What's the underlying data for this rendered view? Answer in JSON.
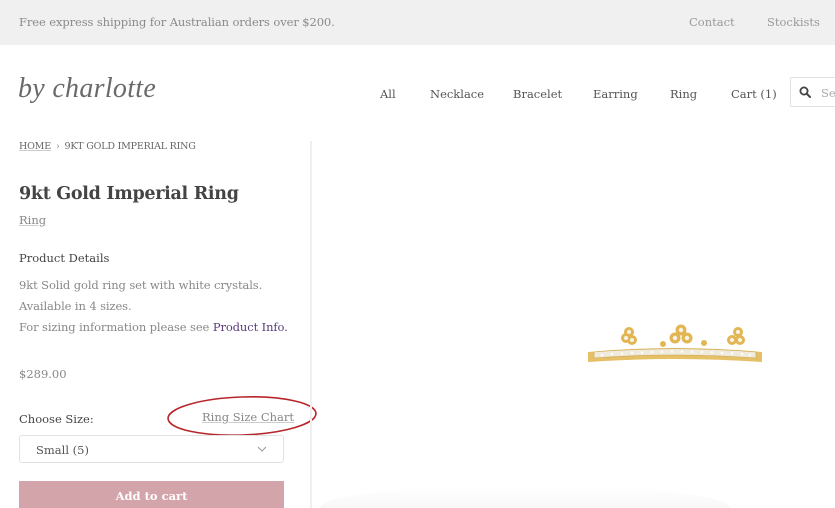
{
  "topbar": {
    "promo": "Free express shipping for Australian orders over $200.",
    "links": [
      "Contact",
      "Stockists"
    ]
  },
  "brand": {
    "logo": "by charlotte"
  },
  "nav": {
    "items": [
      "All",
      "Necklace",
      "Bracelet",
      "Earring",
      "Ring",
      "Cart (1)"
    ],
    "search_placeholder": "Search",
    "search_visible_text": "Sea"
  },
  "breadcrumb": {
    "home": "HOME",
    "separator": "›",
    "current": "9KT GOLD IMPERIAL RING"
  },
  "product": {
    "title": "9kt Gold Imperial Ring",
    "category": "Ring",
    "details_heading": "Product Details",
    "details": [
      "9kt Solid gold ring set with white crystals.",
      "Available in 4 sizes.",
      "For sizing information please see "
    ],
    "details_link": "Product Info.",
    "price": "$289.00",
    "size_label": "Choose Size:",
    "size_chart_link": "Ring Size Chart",
    "size_selected": "Small (5)",
    "add_to_cart": "Add to cart",
    "image_alt": "9kt gold imperial ring with white crystals"
  },
  "colors": {
    "topbar_bg": "#f0f0f0",
    "add_to_cart_bg": "#d3a5ab",
    "link_purple": "#5a3a7a",
    "annotation_red": "#b8262c"
  }
}
